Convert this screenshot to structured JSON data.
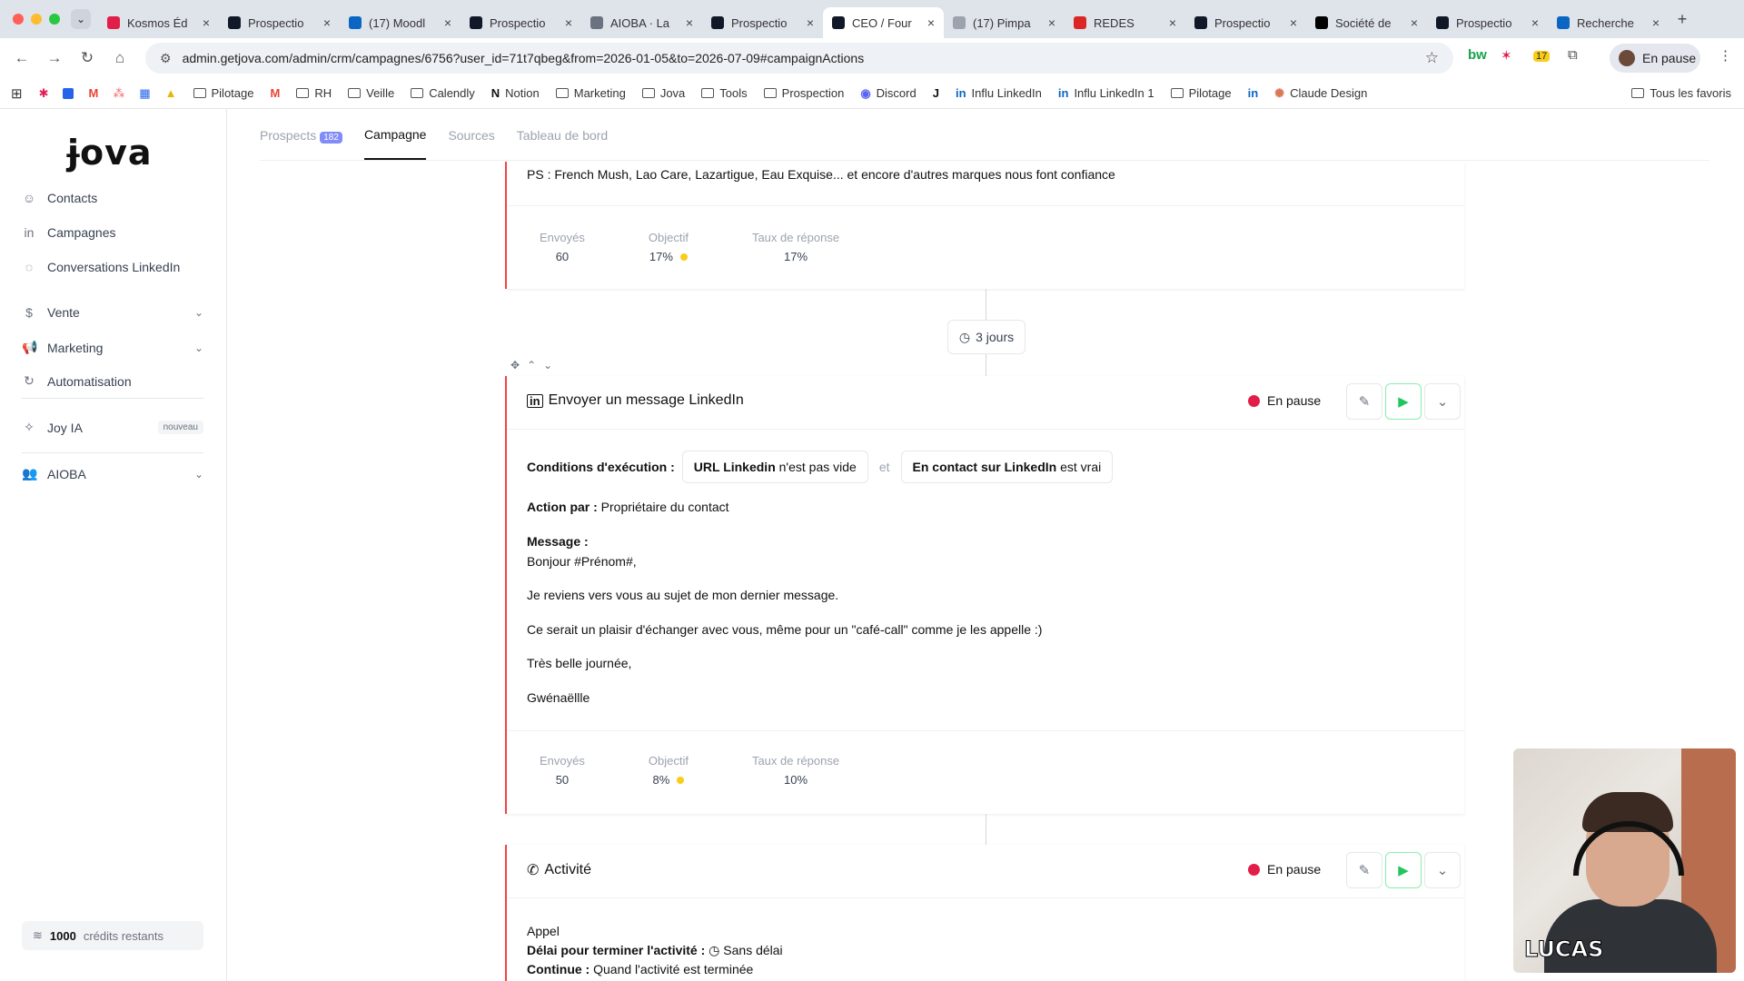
{
  "browser": {
    "tabs": [
      {
        "title": "Kosmos Éd",
        "fav": "kosmos-icon",
        "color": "#e11d48"
      },
      {
        "title": "Prospectio",
        "fav": "jova-icon",
        "color": "#111827"
      },
      {
        "title": "(17) Moodl",
        "fav": "linkedin-icon",
        "color": "#0a66c2"
      },
      {
        "title": "Prospectio",
        "fav": "jova-icon",
        "color": "#111827"
      },
      {
        "title": "AIOBA · La",
        "fav": "aioba-icon",
        "color": "#6b7280"
      },
      {
        "title": "Prospectio",
        "fav": "jova-icon",
        "color": "#111827"
      },
      {
        "title": "CEO / Four",
        "fav": "jova-icon",
        "color": "#111827",
        "active": true
      },
      {
        "title": "(17) Pimpa",
        "fav": "pimpa-icon",
        "color": "#9ca3af"
      },
      {
        "title": "REDES",
        "fav": "redes-icon",
        "color": "#dc2626"
      },
      {
        "title": "Prospectio",
        "fav": "jova-icon",
        "color": "#111827"
      },
      {
        "title": "Société de",
        "fav": "societe-icon",
        "color": "#000000"
      },
      {
        "title": "Prospectio",
        "fav": "jova-icon",
        "color": "#111827"
      },
      {
        "title": "Recherche",
        "fav": "linkedin-icon",
        "color": "#0a66c2"
      }
    ],
    "url": "admin.getjova.com/admin/crm/campagnes/6756?user_id=71t7qbeg&from=2026-01-05&to=2026-07-09#campaignActions",
    "profile_status": "En pause",
    "extension_badge": "17",
    "bookmarks": [
      {
        "label": "Pilotage",
        "icon": "folder"
      },
      {
        "label": "",
        "icon": "gmail-icon"
      },
      {
        "label": "RH",
        "icon": "folder"
      },
      {
        "label": "Veille",
        "icon": "folder"
      },
      {
        "label": "Calendly",
        "icon": "folder"
      },
      {
        "label": "Notion",
        "icon": "notion-icon"
      },
      {
        "label": "Marketing",
        "icon": "folder"
      },
      {
        "label": "Jova",
        "icon": "folder"
      },
      {
        "label": "Tools",
        "icon": "folder"
      },
      {
        "label": "Prospection",
        "icon": "folder"
      },
      {
        "label": "Discord",
        "icon": "discord-icon"
      },
      {
        "label": "",
        "icon": "jova-icon"
      },
      {
        "label": "Influ LinkedIn",
        "icon": "linkedin-icon"
      },
      {
        "label": "Influ LinkedIn 1",
        "icon": "linkedin-icon"
      },
      {
        "label": "Pilotage",
        "icon": "folder"
      },
      {
        "label": "",
        "icon": "linkedin-icon"
      },
      {
        "label": "Claude Design",
        "icon": "claude-icon"
      }
    ],
    "all_bookmarks": "Tous les favoris"
  },
  "sidebar": {
    "logo": "Jova",
    "items": [
      {
        "label": "Contacts",
        "icon": "user-icon"
      },
      {
        "label": "Campagnes",
        "icon": "linkedin-icon"
      },
      {
        "label": "Conversations LinkedIn",
        "icon": "chat-icon"
      },
      {
        "label": "Vente",
        "icon": "dollar-icon"
      },
      {
        "label": "Marketing",
        "icon": "megaphone-icon"
      },
      {
        "label": "Automatisation",
        "icon": "refresh-icon"
      },
      {
        "label": "Joy IA",
        "icon": "sparkle-icon",
        "badge": "nouveau"
      },
      {
        "label": "AIOBA",
        "icon": "users-icon"
      }
    ],
    "credits_count": "1000",
    "credits_label": "crédits restants"
  },
  "subnav": {
    "tabs": [
      "Prospects",
      "Campagne",
      "Sources",
      "Tableau de bord"
    ],
    "prospects_count": "182"
  },
  "top_card": {
    "ps_text": "PS : French Mush, Lao Care, Lazartigue, Eau Exquise... et encore d'autres marques nous font confiance",
    "stats": {
      "sent_label": "Envoyés",
      "sent": "60",
      "goal_label": "Objectif",
      "goal": "17%",
      "rate_label": "Taux de réponse",
      "rate": "17%"
    }
  },
  "delay": {
    "label": "3 jours"
  },
  "message_card": {
    "title": "Envoyer un message LinkedIn",
    "status": "En pause",
    "conditions_label": "Conditions d'exécution :",
    "cond1_field": "URL Linkedin",
    "cond1_op": "n'est pas vide",
    "cond_join": "et",
    "cond2_field": "En contact sur LinkedIn",
    "cond2_op": "est vrai",
    "action_label": "Action par :",
    "action_value": "Propriétaire du contact",
    "message_label": "Message :",
    "message_lines": [
      "Bonjour #Prénom#,",
      "Je reviens vers vous au sujet de mon dernier message.",
      "Ce serait un plaisir d'échanger avec vous, même pour un \"café-call\" comme je les appelle :)",
      "Très belle journée,",
      "Gwénaëllle"
    ],
    "stats": {
      "sent_label": "Envoyés",
      "sent": "50",
      "goal_label": "Objectif",
      "goal": "8%",
      "rate_label": "Taux de réponse",
      "rate": "10%"
    }
  },
  "activity_card": {
    "title": "Activité",
    "status": "En pause",
    "type": "Appel",
    "deadline_label": "Délai pour terminer l'activité :",
    "deadline_value": "Sans délai",
    "continue_label": "Continue :",
    "continue_value": "Quand l'activité est terminée"
  },
  "webcam": {
    "name": "LUCAS"
  },
  "colors": {
    "accent_red": "#ef4444",
    "status_red": "#e11d48",
    "play_green": "#22c55e",
    "goal_yellow": "#facc15",
    "count_badge": "#818cf8"
  }
}
